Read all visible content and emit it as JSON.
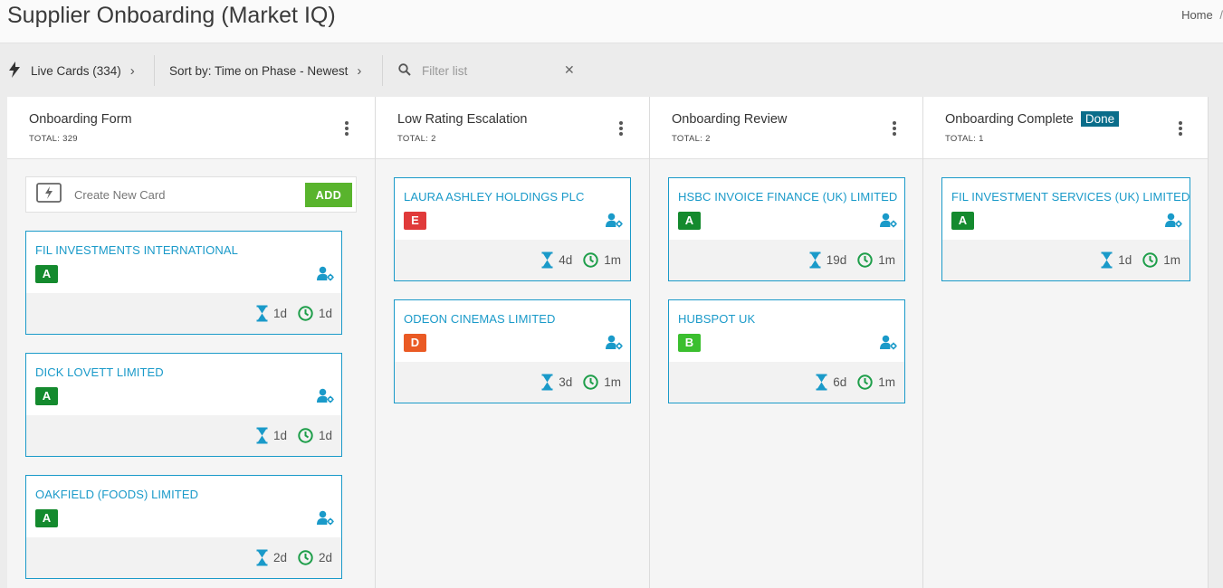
{
  "header": {
    "title": "Supplier Onboarding (Market IQ)",
    "breadcrumb": [
      "Home",
      "/"
    ]
  },
  "toolbar": {
    "live_cards": "Live Cards (334)",
    "sort_by": "Sort by: Time on Phase - Newest",
    "filter_placeholder": "Filter list"
  },
  "create_card": {
    "placeholder": "Create New Card",
    "add_label": "ADD"
  },
  "grade_colors": {
    "A": "#148a2e",
    "B": "#3bbf2f",
    "D": "#ea5a24",
    "E": "#e03a3a"
  },
  "columns": [
    {
      "title": "Onboarding Form",
      "total": "TOTAL: 329",
      "badge": "",
      "cards": [
        {
          "name": "FIL INVESTMENTS INTERNATIONAL",
          "grade": "A",
          "time_on_phase": "1d",
          "age": "1d"
        },
        {
          "name": "DICK LOVETT LIMITED",
          "grade": "A",
          "time_on_phase": "1d",
          "age": "1d"
        },
        {
          "name": "OAKFIELD (FOODS) LIMITED",
          "grade": "A",
          "time_on_phase": "2d",
          "age": "2d"
        }
      ]
    },
    {
      "title": "Low Rating Escalation",
      "total": "TOTAL: 2",
      "badge": "",
      "cards": [
        {
          "name": "LAURA ASHLEY HOLDINGS PLC",
          "grade": "E",
          "time_on_phase": "4d",
          "age": "1m"
        },
        {
          "name": "ODEON CINEMAS LIMITED",
          "grade": "D",
          "time_on_phase": "3d",
          "age": "1m"
        }
      ]
    },
    {
      "title": "Onboarding Review",
      "total": "TOTAL: 2",
      "badge": "",
      "cards": [
        {
          "name": "HSBC INVOICE FINANCE (UK) LIMITED",
          "grade": "A",
          "time_on_phase": "19d",
          "age": "1m"
        },
        {
          "name": "HUBSPOT UK",
          "grade": "B",
          "time_on_phase": "6d",
          "age": "1m"
        }
      ]
    },
    {
      "title": "Onboarding Complete",
      "total": "TOTAL: 1",
      "badge": "Done",
      "cards": [
        {
          "name": "FIL INVESTMENT SERVICES (UK) LIMITED",
          "grade": "A",
          "time_on_phase": "1d",
          "age": "1m"
        }
      ]
    }
  ]
}
